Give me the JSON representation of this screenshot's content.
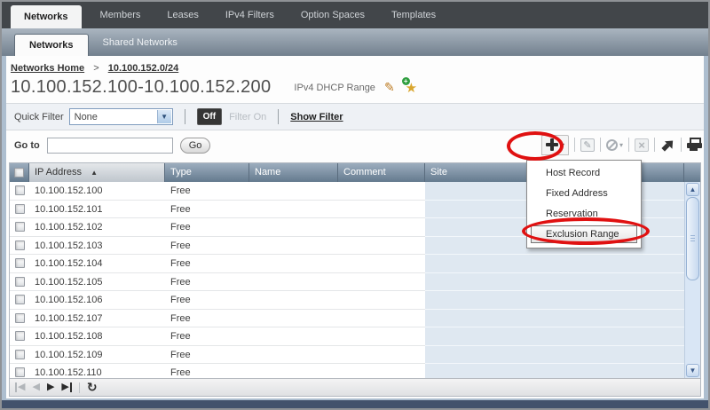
{
  "colors": {
    "annotation_red": "#e01111",
    "topbar_bg": "#42464a",
    "subbar_gradient": [
      "#aab5c0",
      "#72808e"
    ],
    "grid_header_gradient": [
      "#9cadbe",
      "#647a8e"
    ],
    "sorted_header_gradient": [
      "#e4e7ea",
      "#bfc6cd"
    ],
    "site_column_bg": "#dfe8f1",
    "scrollbar_track": "#d9e6f5",
    "bottom_strip": "#42526c"
  },
  "top_tabs": [
    {
      "label": "Networks",
      "active": true
    },
    {
      "label": "Members",
      "active": false
    },
    {
      "label": "Leases",
      "active": false
    },
    {
      "label": "IPv4 Filters",
      "active": false
    },
    {
      "label": "Option Spaces",
      "active": false
    },
    {
      "label": "Templates",
      "active": false
    }
  ],
  "sub_tabs": [
    {
      "label": "Networks",
      "active": true
    },
    {
      "label": "Shared Networks",
      "active": false
    }
  ],
  "breadcrumb": {
    "home": "Networks Home",
    "separator": ">",
    "network": "10.100.152.0/24"
  },
  "page": {
    "title": "10.100.152.100-10.100.152.200",
    "type_label": "IPv4 DHCP Range",
    "icons": [
      "edit-pencil-icon",
      "add-to-favorites-star-icon"
    ]
  },
  "filter_bar": {
    "label": "Quick Filter",
    "selected": "None",
    "toggle_label": "Off",
    "state_label": "Filter On",
    "show_filter_label": "Show Filter"
  },
  "goto": {
    "label": "Go to",
    "value": "",
    "button_label": "Go"
  },
  "toolbar": {
    "icons": [
      "add-plus-icon",
      "edit-icon",
      "disable-icon",
      "delete-icon",
      "move-arrow-icon",
      "print-icon"
    ],
    "add_menu_open": true
  },
  "add_menu": {
    "items": [
      "Host Record",
      "Fixed Address",
      "Reservation",
      "Exclusion Range"
    ],
    "highlighted": "Exclusion Range"
  },
  "table": {
    "columns": [
      "IP Address",
      "Type",
      "Name",
      "Comment",
      "Site"
    ],
    "sort_column": "IP Address",
    "sort_indicator": "▲",
    "rows": [
      {
        "ip": "10.100.152.100",
        "type": "Free",
        "name": "",
        "comment": "",
        "site": ""
      },
      {
        "ip": "10.100.152.101",
        "type": "Free",
        "name": "",
        "comment": "",
        "site": ""
      },
      {
        "ip": "10.100.152.102",
        "type": "Free",
        "name": "",
        "comment": "",
        "site": ""
      },
      {
        "ip": "10.100.152.103",
        "type": "Free",
        "name": "",
        "comment": "",
        "site": ""
      },
      {
        "ip": "10.100.152.104",
        "type": "Free",
        "name": "",
        "comment": "",
        "site": ""
      },
      {
        "ip": "10.100.152.105",
        "type": "Free",
        "name": "",
        "comment": "",
        "site": ""
      },
      {
        "ip": "10.100.152.106",
        "type": "Free",
        "name": "",
        "comment": "",
        "site": ""
      },
      {
        "ip": "10.100.152.107",
        "type": "Free",
        "name": "",
        "comment": "",
        "site": ""
      },
      {
        "ip": "10.100.152.108",
        "type": "Free",
        "name": "",
        "comment": "",
        "site": ""
      },
      {
        "ip": "10.100.152.109",
        "type": "Free",
        "name": "",
        "comment": "",
        "site": ""
      },
      {
        "ip": "10.100.152.110",
        "type": "Free",
        "name": "",
        "comment": "",
        "site": ""
      }
    ]
  },
  "pager": {
    "icons": [
      "first-page-icon",
      "previous-page-icon",
      "next-page-icon",
      "last-page-icon",
      "refresh-icon"
    ]
  },
  "annotations": [
    {
      "shape": "ellipse",
      "target": "add-button"
    },
    {
      "shape": "ellipse",
      "target": "menu-item-exclusion-range"
    }
  ]
}
